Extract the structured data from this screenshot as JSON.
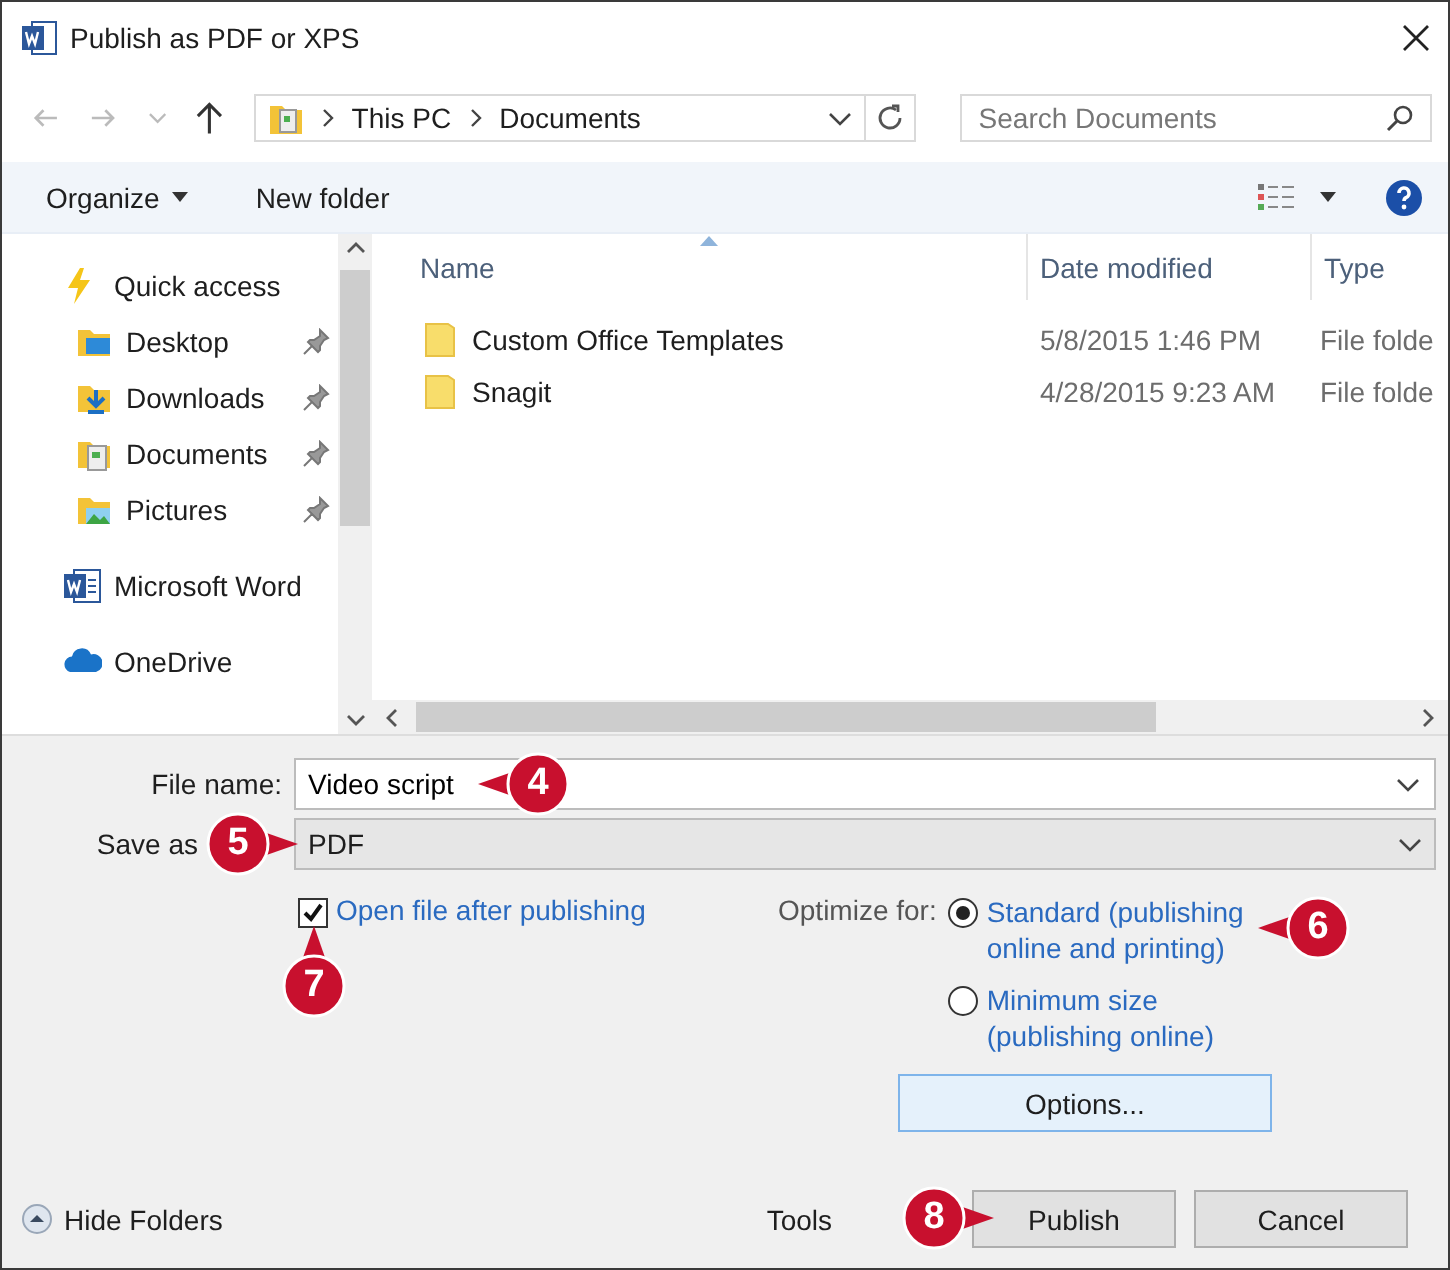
{
  "window": {
    "title": "Publish as PDF or XPS"
  },
  "address": {
    "crumbs": [
      "This PC",
      "Documents"
    ]
  },
  "search": {
    "placeholder": "Search Documents"
  },
  "toolbar": {
    "organize": "Organize",
    "new_folder": "New folder"
  },
  "sidebar": {
    "items": [
      {
        "label": "Quick access",
        "kind": "quick",
        "children": [
          {
            "label": "Desktop",
            "kind": "desktop",
            "pinned": true
          },
          {
            "label": "Downloads",
            "kind": "downloads",
            "pinned": true
          },
          {
            "label": "Documents",
            "kind": "documents",
            "pinned": true
          },
          {
            "label": "Pictures",
            "kind": "pictures",
            "pinned": true
          }
        ]
      },
      {
        "label": "Microsoft Word",
        "kind": "word"
      },
      {
        "label": "OneDrive",
        "kind": "cloud"
      }
    ]
  },
  "file_list": {
    "columns": [
      {
        "label": "Name",
        "sorted": true
      },
      {
        "label": "Date modified",
        "sorted": false
      },
      {
        "label": "Type",
        "sorted": false
      }
    ],
    "rows": [
      {
        "name": "Custom Office Templates",
        "date": "5/8/2015 1:46 PM",
        "type": "File folde"
      },
      {
        "name": "Snagit",
        "date": "4/28/2015 9:23 AM",
        "type": "File folde"
      }
    ]
  },
  "form": {
    "file_name": {
      "label": "File name:",
      "value": "Video script",
      "callout": "4"
    },
    "save_as": {
      "label": "Save as",
      "value": "PDF",
      "callout": "5"
    },
    "open_after": {
      "label": "Open file after publishing",
      "checked": true,
      "callout": "7"
    },
    "optimize": {
      "label": "Optimize for:",
      "options": [
        {
          "label": "Standard (publishing online and printing)",
          "selected": true,
          "callout": "6"
        },
        {
          "label": "Minimum size (publishing online)",
          "selected": false
        }
      ]
    },
    "options_button": "Options...",
    "hide_folders": "Hide Folders",
    "tools": "Tools",
    "publish": {
      "label": "Publish",
      "callout": "8"
    },
    "cancel": "Cancel"
  }
}
